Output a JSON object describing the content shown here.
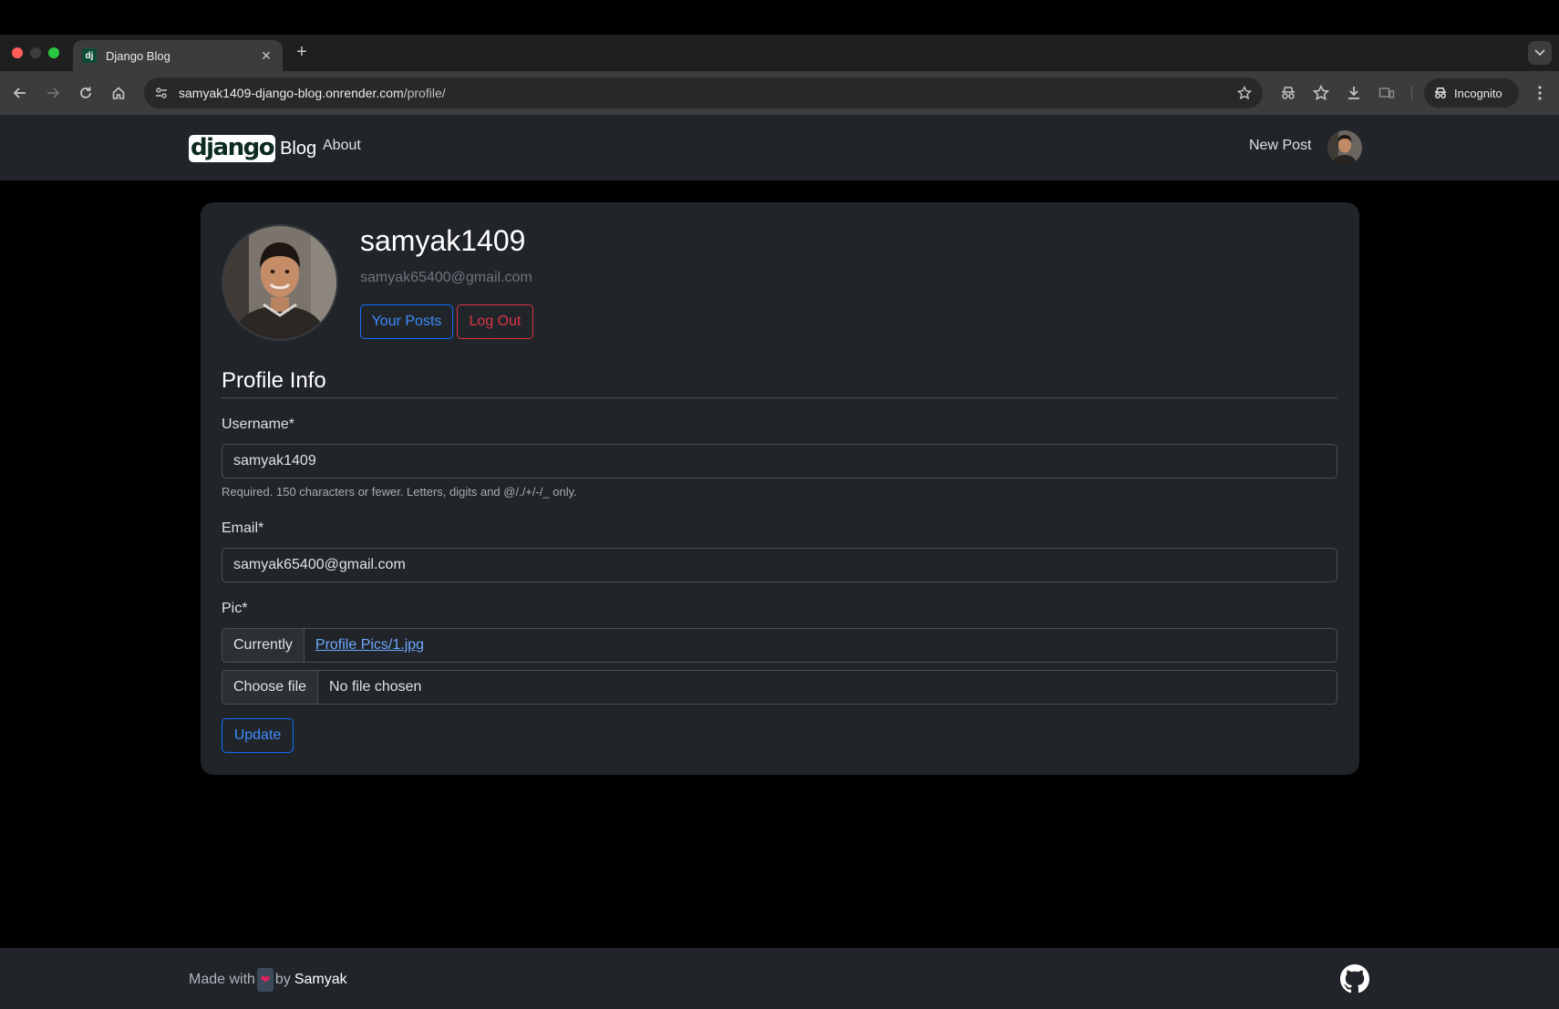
{
  "browser": {
    "tab_title": "Django Blog",
    "tab_favicon": "dj",
    "url_host": "samyak1409-django-blog.onrender.com",
    "url_path": "/profile/",
    "incognito_label": "Incognito"
  },
  "navbar": {
    "logo_text": "django",
    "brand_text": "Blog",
    "about_label": "About",
    "new_post_label": "New Post"
  },
  "profile": {
    "username": "samyak1409",
    "email": "samyak65400@gmail.com",
    "your_posts_label": "Your Posts",
    "logout_label": "Log Out"
  },
  "form": {
    "section_title": "Profile Info",
    "username_label": "Username*",
    "username_value": "samyak1409",
    "username_help": "Required. 150 characters or fewer. Letters, digits and @/./+/-/_ only.",
    "email_label": "Email*",
    "email_value": "samyak65400@gmail.com",
    "pic_label": "Pic*",
    "currently_label": "Currently",
    "current_file": "Profile Pics/1.jpg",
    "choose_file_label": "Choose file",
    "no_file_label": "No file chosen",
    "update_label": "Update"
  },
  "footer": {
    "made_with": "Made with",
    "by": "by",
    "author": "Samyak"
  },
  "colors": {
    "primary": "#0d6efd",
    "danger": "#dc3545",
    "card_bg": "#212529",
    "page_bg": "#000000"
  }
}
